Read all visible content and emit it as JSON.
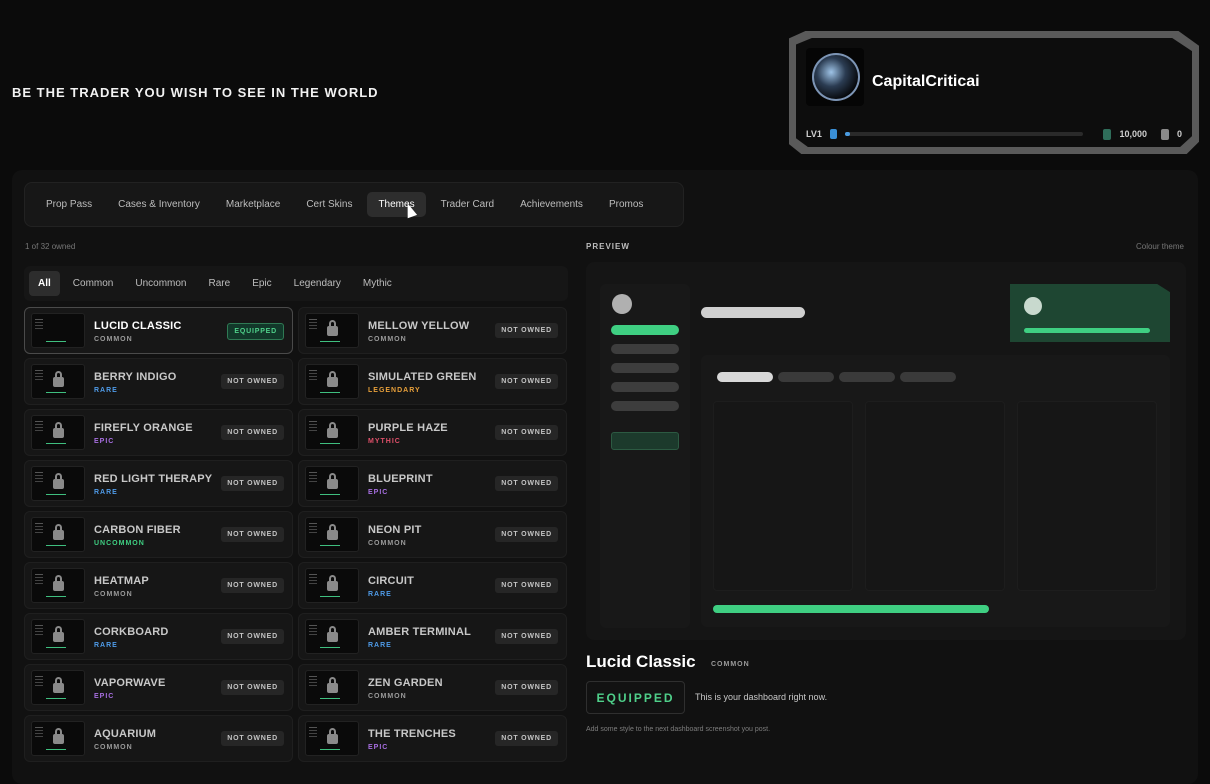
{
  "tagline": "BE THE TRADER YOU WISH TO SEE IN THE WORLD",
  "profile": {
    "username": "CapitalCriticai",
    "level": "LV1",
    "xp_progress": 0.02,
    "coins": "10,000",
    "trophies": "0"
  },
  "tabs": [
    "Prop Pass",
    "Cases & Inventory",
    "Marketplace",
    "Cert Skins",
    "Themes",
    "Trader Card",
    "Achievements",
    "Promos"
  ],
  "active_tab": "Themes",
  "owned_text": "1 of 32 owned",
  "preview_label": "PREVIEW",
  "colour_theme_label": "Colour theme",
  "filters": [
    "All",
    "Common",
    "Uncommon",
    "Rare",
    "Epic",
    "Legendary",
    "Mythic"
  ],
  "active_filter": "All",
  "rarity_colors": {
    "COMMON": "#9a9a9a",
    "UNCOMMON": "#3fcf82",
    "RARE": "#4f9be8",
    "EPIC": "#a66ee0",
    "LEGENDARY": "#e8a03a",
    "MYTHIC": "#e0506a"
  },
  "themes": [
    {
      "name": "LUCID CLASSIC",
      "rarity": "COMMON",
      "status": "EQUIPPED"
    },
    {
      "name": "MELLOW YELLOW",
      "rarity": "COMMON",
      "status": "NOT OWNED"
    },
    {
      "name": "BERRY INDIGO",
      "rarity": "RARE",
      "status": "NOT OWNED"
    },
    {
      "name": "SIMULATED GREEN",
      "rarity": "LEGENDARY",
      "status": "NOT OWNED"
    },
    {
      "name": "FIREFLY ORANGE",
      "rarity": "EPIC",
      "status": "NOT OWNED"
    },
    {
      "name": "PURPLE HAZE",
      "rarity": "MYTHIC",
      "status": "NOT OWNED"
    },
    {
      "name": "RED LIGHT THERAPY",
      "rarity": "RARE",
      "status": "NOT OWNED"
    },
    {
      "name": "BLUEPRINT",
      "rarity": "EPIC",
      "status": "NOT OWNED"
    },
    {
      "name": "CARBON FIBER",
      "rarity": "UNCOMMON",
      "status": "NOT OWNED"
    },
    {
      "name": "NEON PIT",
      "rarity": "COMMON",
      "status": "NOT OWNED"
    },
    {
      "name": "HEATMAP",
      "rarity": "COMMON",
      "status": "NOT OWNED"
    },
    {
      "name": "CIRCUIT",
      "rarity": "RARE",
      "status": "NOT OWNED"
    },
    {
      "name": "CORKBOARD",
      "rarity": "RARE",
      "status": "NOT OWNED"
    },
    {
      "name": "AMBER TERMINAL",
      "rarity": "RARE",
      "status": "NOT OWNED"
    },
    {
      "name": "VAPORWAVE",
      "rarity": "EPIC",
      "status": "NOT OWNED"
    },
    {
      "name": "ZEN GARDEN",
      "rarity": "COMMON",
      "status": "NOT OWNED"
    },
    {
      "name": "AQUARIUM",
      "rarity": "COMMON",
      "status": "NOT OWNED"
    },
    {
      "name": "THE TRENCHES",
      "rarity": "EPIC",
      "status": "NOT OWNED"
    }
  ],
  "selected_theme": {
    "title": "Lucid Classic",
    "rarity": "COMMON",
    "status": "EQUIPPED",
    "description": "This is your dashboard right now.",
    "note": "Add some style to the next dashboard screenshot you post."
  }
}
